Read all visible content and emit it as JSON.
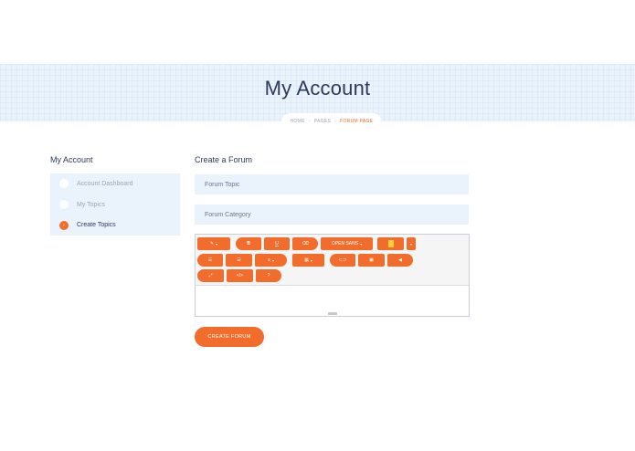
{
  "hero": {
    "title": "My Account"
  },
  "breadcrumb": {
    "home": "HOME",
    "pages": "PAGES",
    "current": "FORUM PAGE",
    "separator": "›"
  },
  "sidebar": {
    "title": "My Account",
    "items": [
      {
        "label": "Account Dashboard",
        "active": false
      },
      {
        "label": "My Topics",
        "active": false
      },
      {
        "label": "Create Topics",
        "active": true
      }
    ]
  },
  "main": {
    "title": "Create a Forum",
    "topic_placeholder": "Forum Topic",
    "category_placeholder": "Forum Category"
  },
  "editor": {
    "font_label": "OPEN SANS",
    "buttons": {
      "style": "✎",
      "bold": "B",
      "underline": "U",
      "clear": "⌫",
      "ul": "☰",
      "ol": "☰",
      "align": "≡",
      "table": "▦",
      "link": "⊂⊃",
      "image": "▣",
      "video": "◀",
      "fullscreen": "⤢",
      "code": "</>",
      "help": "?"
    }
  },
  "actions": {
    "submit_label": "CREATE FORUM"
  },
  "colors": {
    "accent": "#f26c2c",
    "light_bg": "#eaf3fc",
    "text": "#2f3a5a"
  }
}
